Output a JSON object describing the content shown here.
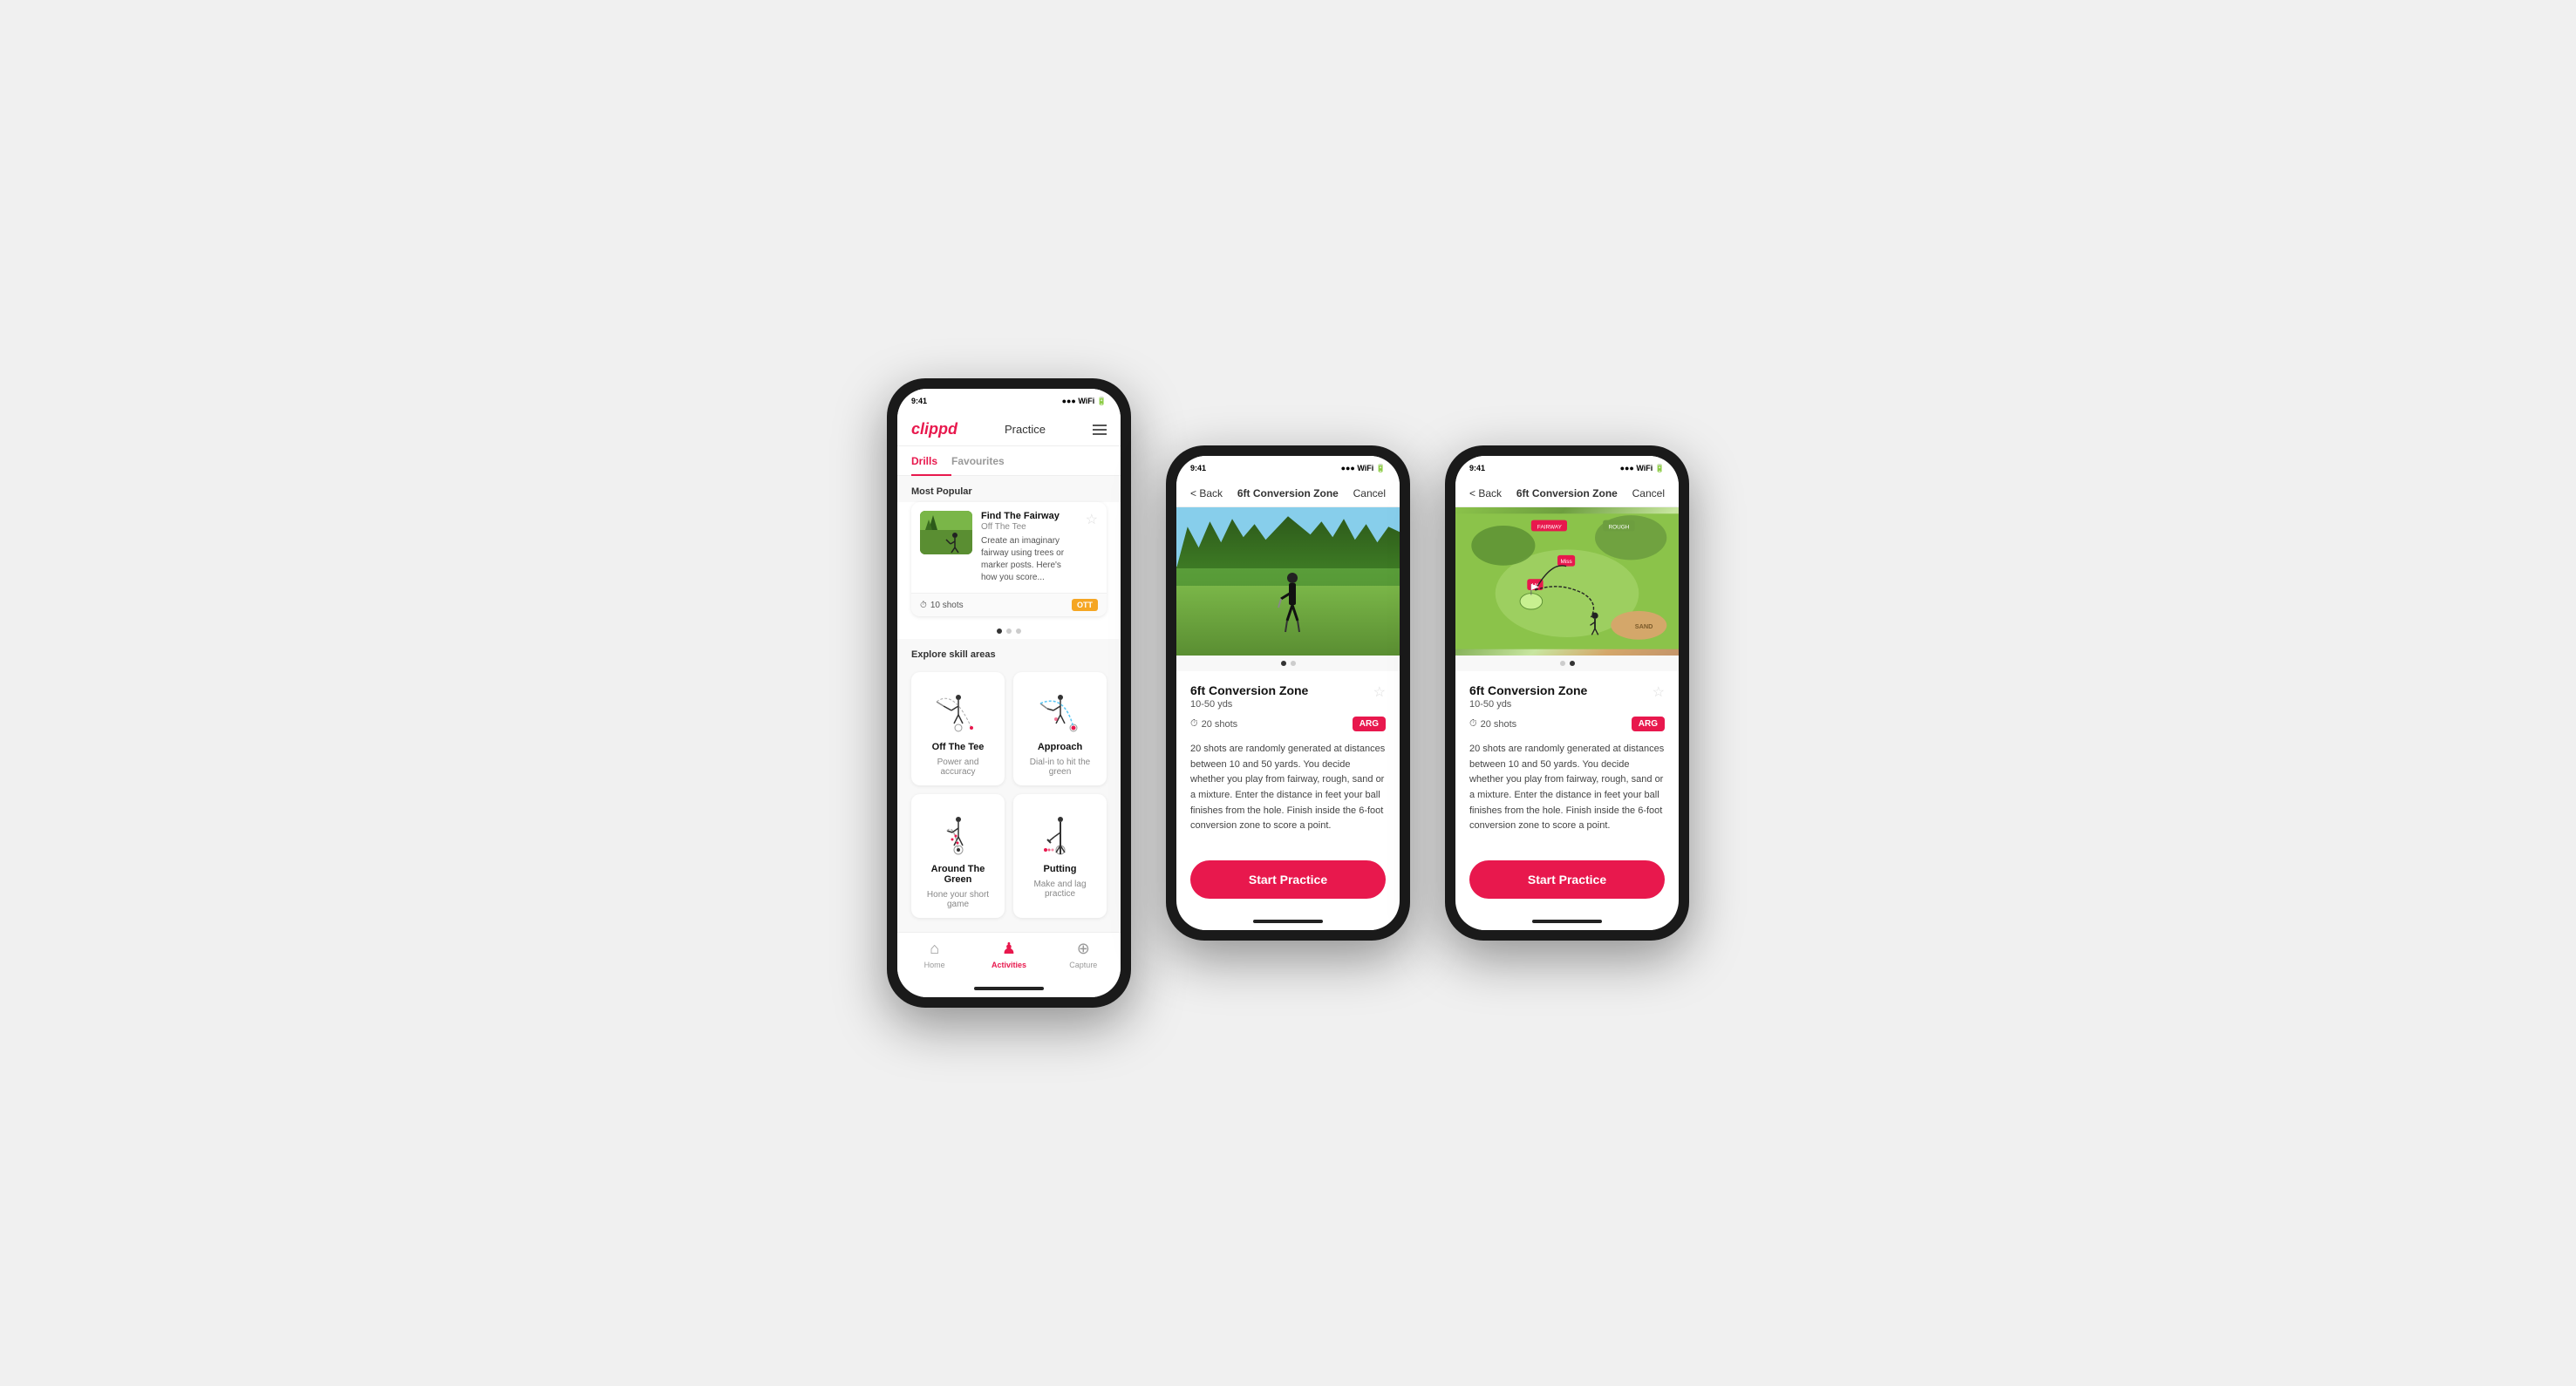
{
  "phones": {
    "phone1": {
      "header": {
        "logo": "clippd",
        "title": "Practice"
      },
      "tabs": [
        "Drills",
        "Favourites"
      ],
      "active_tab": "Drills",
      "most_popular_label": "Most Popular",
      "drill_card": {
        "title": "Find The Fairway",
        "subtitle": "Off The Tee",
        "description": "Create an imaginary fairway using trees or marker posts. Here's how you score...",
        "shots": "10 shots",
        "badge": "OTT",
        "fav": "☆"
      },
      "dots": [
        true,
        false,
        false
      ],
      "explore_label": "Explore skill areas",
      "skills": [
        {
          "name": "Off The Tee",
          "desc": "Power and accuracy",
          "icon": "ott"
        },
        {
          "name": "Approach",
          "desc": "Dial-in to hit the green",
          "icon": "approach"
        },
        {
          "name": "Around The Green",
          "desc": "Hone your short game",
          "icon": "atg"
        },
        {
          "name": "Putting",
          "desc": "Make and lag practice",
          "icon": "putting"
        }
      ],
      "bottom_nav": [
        {
          "label": "Home",
          "icon": "🏠",
          "active": false
        },
        {
          "label": "Activities",
          "icon": "🏌",
          "active": true
        },
        {
          "label": "Capture",
          "icon": "⊕",
          "active": false
        }
      ]
    },
    "phone2": {
      "header": {
        "back": "< Back",
        "title": "6ft Conversion Zone",
        "cancel": "Cancel"
      },
      "drill": {
        "title": "6ft Conversion Zone",
        "range": "10-50 yds",
        "shots": "20 shots",
        "badge": "ARG",
        "fav": "☆",
        "description": "20 shots are randomly generated at distances between 10 and 50 yards. You decide whether you play from fairway, rough, sand or a mixture. Enter the distance in feet your ball finishes from the hole. Finish inside the 6-foot conversion zone to score a point.",
        "start_button": "Start Practice"
      },
      "dots": [
        true,
        false
      ],
      "image_type": "photo"
    },
    "phone3": {
      "header": {
        "back": "< Back",
        "title": "6ft Conversion Zone",
        "cancel": "Cancel"
      },
      "drill": {
        "title": "6ft Conversion Zone",
        "range": "10-50 yds",
        "shots": "20 shots",
        "badge": "ARG",
        "fav": "☆",
        "description": "20 shots are randomly generated at distances between 10 and 50 yards. You decide whether you play from fairway, rough, sand or a mixture. Enter the distance in feet your ball finishes from the hole. Finish inside the 6-foot conversion zone to score a point.",
        "start_button": "Start Practice"
      },
      "dots": [
        false,
        true
      ],
      "image_type": "map"
    }
  }
}
